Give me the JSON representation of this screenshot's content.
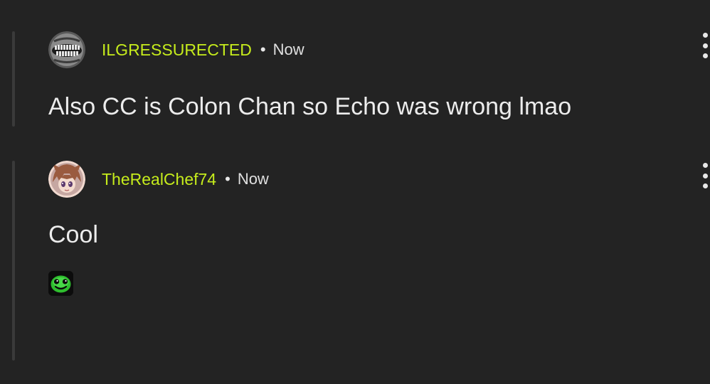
{
  "comments": [
    {
      "username": "ILGRESSURECTED",
      "separator": "•",
      "timestamp": "Now",
      "text": "Also CC is Colon Chan so Echo was wrong lmao",
      "avatar_icon": "grinning-monster-avatar"
    },
    {
      "username": "TheRealChef74",
      "separator": "•",
      "timestamp": "Now",
      "text": "Cool",
      "avatar_icon": "anime-girl-avatar",
      "attachment_icon": "green-smiley-cube-icon"
    }
  ],
  "colors": {
    "background": "#232323",
    "username": "#c6ec1c",
    "text": "#ececec",
    "thread_line": "#3a3a3a"
  }
}
